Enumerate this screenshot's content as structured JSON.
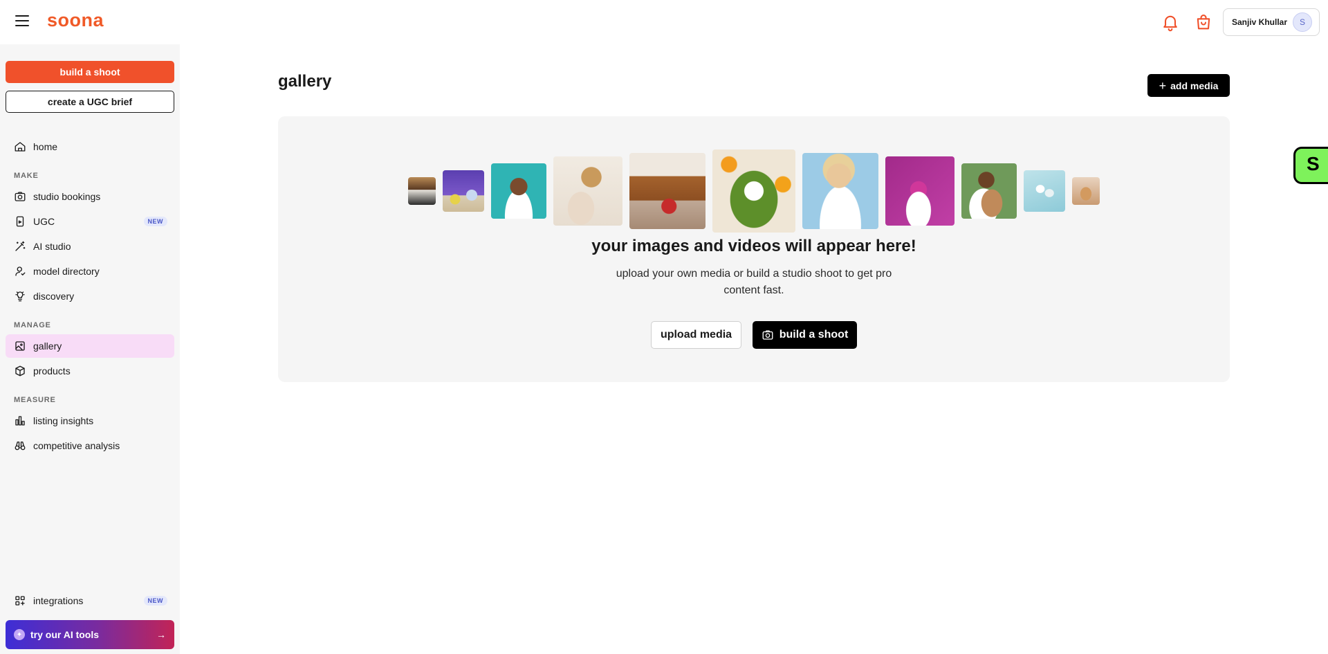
{
  "header": {
    "logo": "soona",
    "user_name": "Sanjiv Khullar",
    "user_initial": "S",
    "icons": [
      "menu-icon",
      "bell-icon",
      "shopping-bag-icon"
    ]
  },
  "sidebar": {
    "build_shoot_label": "build a shoot",
    "ugc_brief_label": "create a UGC brief",
    "home_label": "home",
    "make_section": "MAKE",
    "studio_bookings_label": "studio bookings",
    "ugc_label": "UGC",
    "ugc_badge": "NEW",
    "ai_studio_label": "AI studio",
    "model_directory_label": "model directory",
    "discovery_label": "discovery",
    "manage_section": "MANAGE",
    "gallery_label": "gallery",
    "products_label": "products",
    "measure_section": "MEASURE",
    "listing_insights_label": "listing insights",
    "competitive_analysis_label": "competitive analysis",
    "integrations_label": "integrations",
    "integrations_badge": "NEW",
    "ai_tools_label": "try our AI tools"
  },
  "main": {
    "title": "gallery",
    "add_media_label": "add media",
    "empty_heading": "your images and videos will appear here!",
    "empty_subtext": "upload your own media or build a studio shoot to get pro content fast.",
    "upload_media_label": "upload media",
    "build_shoot_label": "build a shoot"
  },
  "floating_widget": {
    "letter": "S"
  },
  "colors": {
    "brand_orange": "#f05a28",
    "active_nav_bg": "#f8dcf7",
    "badge_blue": "#4a57c7",
    "widget_green": "#7ef25b"
  }
}
